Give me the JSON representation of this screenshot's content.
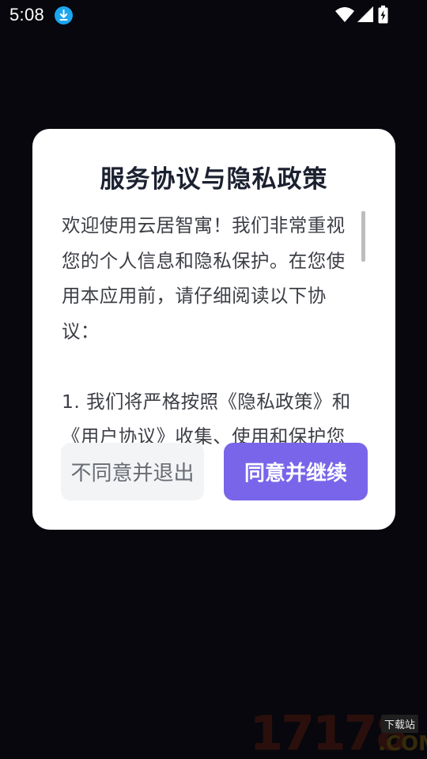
{
  "status_bar": {
    "time": "5:08",
    "icons": [
      "download-icon",
      "wifi-icon",
      "signal-icon",
      "battery-charging-icon"
    ]
  },
  "dialog": {
    "title": "服务协议与隐私政策",
    "content": "欢迎使用云居智寓！我们非常重视您的个人信息和隐私保护。在您使用本应用前，请仔细阅读以下协议：\n\n1. 我们将严格按照《隐私政策》和《用户协议》收集、使用和保护您的信息",
    "decline_label": "不同意并退出",
    "accept_label": "同意并继续"
  },
  "colors": {
    "background": "#07070d",
    "dialog_bg": "#ffffff",
    "accent": "#7865ea",
    "decline_bg": "#f3f4f6",
    "download_badge": "#1aa6f0"
  },
  "watermark": {
    "digits": "17178",
    "badge": "下载站",
    "suffix": ".COM"
  }
}
